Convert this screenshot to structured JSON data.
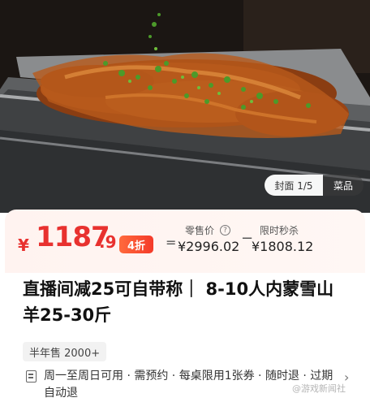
{
  "hero": {
    "image_counter": "封面 1/5",
    "category_label": "菜品"
  },
  "price": {
    "currency": "¥",
    "integer": "1187",
    "decimal": ".9",
    "discount_badge": "4折",
    "equals": "=",
    "retail_label": "零售价",
    "retail_value": "¥2996.02",
    "minus": "−",
    "flash_label": "限时秒杀",
    "flash_value": "¥1808.12"
  },
  "product": {
    "title": "直播间减25可自带称｜ 8-10人内蒙雪山羊25-30斤",
    "sales_tag": "半年售 2000+",
    "rules": "周一至周日可用 · 需预约 · 每桌限用1张券 · 随时退 · 过期自动退"
  },
  "watermark": "@游戏新闻社",
  "colors": {
    "price_red": "#e8312f",
    "badge_gradient_start": "#ff6a3c",
    "badge_gradient_end": "#f43a2a",
    "panel_bg": "#fff3f0"
  },
  "icons": {
    "help": "question-circle-icon",
    "rules": "document-icon",
    "chevron": "chevron-right-icon"
  }
}
